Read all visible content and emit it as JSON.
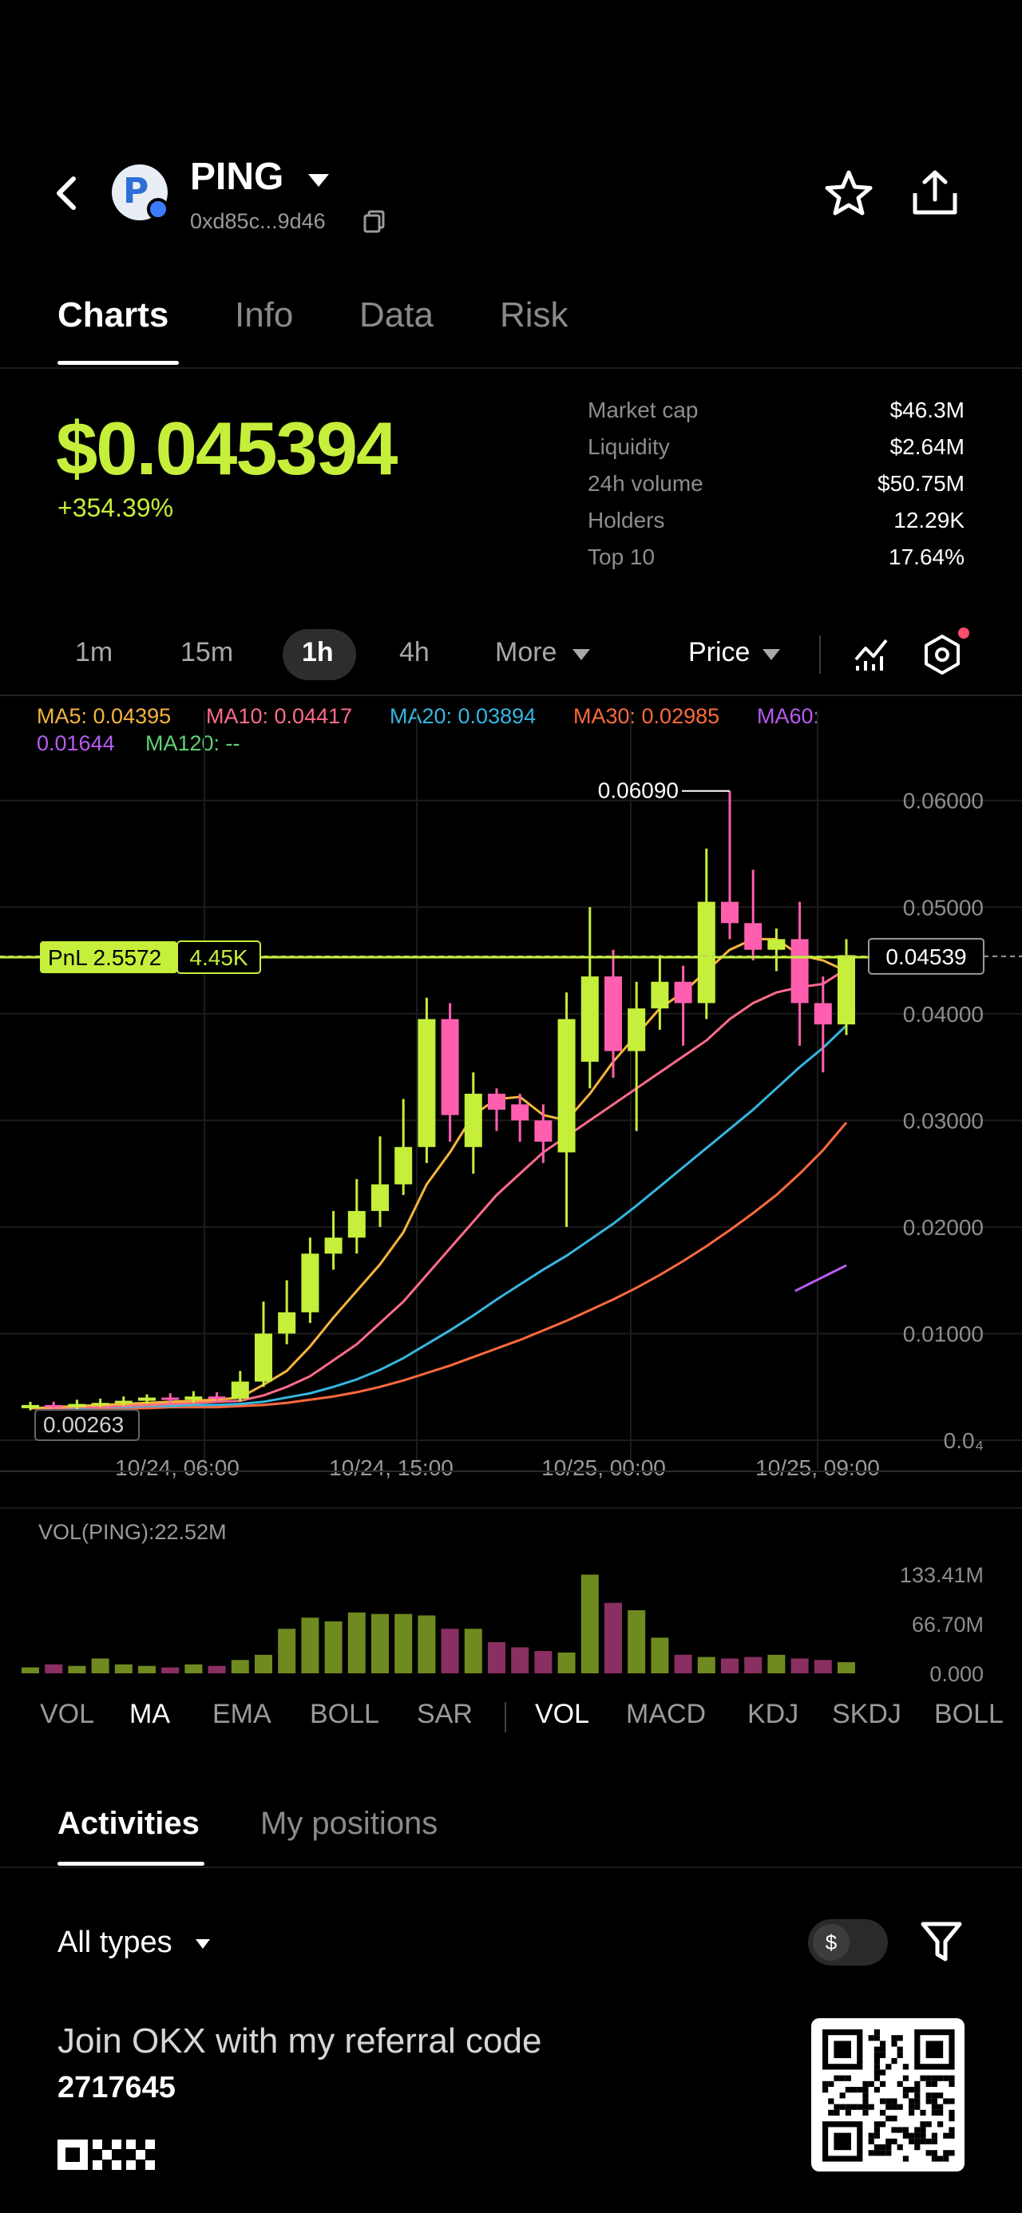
{
  "header": {
    "token_name": "PING",
    "token_address": "0xd85c...9d46"
  },
  "tabs": [
    {
      "label": "Charts",
      "active": true
    },
    {
      "label": "Info",
      "active": false
    },
    {
      "label": "Data",
      "active": false
    },
    {
      "label": "Risk",
      "active": false
    }
  ],
  "price": {
    "value": "$0.045394",
    "change": "+354.39%"
  },
  "stats": [
    {
      "label": "Market cap",
      "value": "$46.3M"
    },
    {
      "label": "Liquidity",
      "value": "$2.64M"
    },
    {
      "label": "24h volume",
      "value": "$50.75M"
    },
    {
      "label": "Holders",
      "value": "12.29K"
    },
    {
      "label": "Top 10",
      "value": "17.64%"
    }
  ],
  "timeframes": [
    "1m",
    "15m",
    "1h",
    "4h"
  ],
  "timeframe_active": "1h",
  "more_label": "More",
  "price_mode_label": "Price",
  "ma_legend": {
    "ma5": "MA5: 0.04395",
    "ma10": "MA10: 0.04417",
    "ma20": "MA20: 0.03894",
    "ma30": "MA30: 0.02985",
    "ma60_a": "MA60:",
    "ma60_b": "0.01644",
    "ma120": "MA120: --"
  },
  "colors": {
    "up": "#c5ef3a",
    "down": "#ff5fae",
    "ma5": "#f5b43c",
    "ma10": "#ff6b8a",
    "ma20": "#35b6e0",
    "ma30": "#ff6a3d",
    "ma60": "#b65cf0",
    "ma120": "#5fd37a"
  },
  "pnl": {
    "label": "PnL 2.5572",
    "amount": "4.45K"
  },
  "chart_data": {
    "type": "candlestick",
    "y_ticks": [
      "0.06000",
      "0.05000",
      "0.04000",
      "0.03000",
      "0.02000",
      "0.01000",
      "0.0₄"
    ],
    "ylim": [
      0,
      0.0635
    ],
    "x_ticks": [
      "10/24, 06:00",
      "10/24, 15:00",
      "10/25, 00:00",
      "10/25, 09:00"
    ],
    "high_label": "0.06090",
    "low_label": "0.00263",
    "current_price_label": "0.04539",
    "current_price": 0.04539,
    "candles": [
      {
        "o": 0.003,
        "c": 0.0033,
        "h": 0.0036,
        "l": 0.0028
      },
      {
        "o": 0.0033,
        "c": 0.0031,
        "h": 0.0036,
        "l": 0.0029
      },
      {
        "o": 0.0031,
        "c": 0.0034,
        "h": 0.0038,
        "l": 0.0029
      },
      {
        "o": 0.0034,
        "c": 0.0035,
        "h": 0.0039,
        "l": 0.0031
      },
      {
        "o": 0.0035,
        "c": 0.0037,
        "h": 0.0041,
        "l": 0.0032
      },
      {
        "o": 0.0037,
        "c": 0.004,
        "h": 0.0043,
        "l": 0.0034
      },
      {
        "o": 0.004,
        "c": 0.0038,
        "h": 0.0044,
        "l": 0.0035
      },
      {
        "o": 0.0038,
        "c": 0.0041,
        "h": 0.0046,
        "l": 0.0035
      },
      {
        "o": 0.0041,
        "c": 0.0039,
        "h": 0.0045,
        "l": 0.0036
      },
      {
        "o": 0.0039,
        "c": 0.0055,
        "h": 0.0065,
        "l": 0.0036
      },
      {
        "o": 0.0055,
        "c": 0.01,
        "h": 0.013,
        "l": 0.005
      },
      {
        "o": 0.01,
        "c": 0.012,
        "h": 0.015,
        "l": 0.009
      },
      {
        "o": 0.012,
        "c": 0.0175,
        "h": 0.019,
        "l": 0.011
      },
      {
        "o": 0.0175,
        "c": 0.019,
        "h": 0.0215,
        "l": 0.016
      },
      {
        "o": 0.019,
        "c": 0.0215,
        "h": 0.0245,
        "l": 0.0175
      },
      {
        "o": 0.0215,
        "c": 0.024,
        "h": 0.0285,
        "l": 0.02
      },
      {
        "o": 0.024,
        "c": 0.0275,
        "h": 0.032,
        "l": 0.023
      },
      {
        "o": 0.0275,
        "c": 0.0395,
        "h": 0.0415,
        "l": 0.026
      },
      {
        "o": 0.0395,
        "c": 0.0305,
        "h": 0.041,
        "l": 0.028
      },
      {
        "o": 0.0275,
        "c": 0.0325,
        "h": 0.0345,
        "l": 0.025
      },
      {
        "o": 0.0325,
        "c": 0.031,
        "h": 0.033,
        "l": 0.029
      },
      {
        "o": 0.0315,
        "c": 0.03,
        "h": 0.0325,
        "l": 0.028
      },
      {
        "o": 0.03,
        "c": 0.028,
        "h": 0.0315,
        "l": 0.026
      },
      {
        "o": 0.027,
        "c": 0.0395,
        "h": 0.042,
        "l": 0.02
      },
      {
        "o": 0.0355,
        "c": 0.0435,
        "h": 0.05,
        "l": 0.033
      },
      {
        "o": 0.0435,
        "c": 0.0365,
        "h": 0.046,
        "l": 0.034
      },
      {
        "o": 0.0365,
        "c": 0.0405,
        "h": 0.043,
        "l": 0.029
      },
      {
        "o": 0.0405,
        "c": 0.043,
        "h": 0.0455,
        "l": 0.0385
      },
      {
        "o": 0.043,
        "c": 0.041,
        "h": 0.0445,
        "l": 0.037
      },
      {
        "o": 0.041,
        "c": 0.0505,
        "h": 0.0555,
        "l": 0.0395
      },
      {
        "o": 0.0505,
        "c": 0.0485,
        "h": 0.0609,
        "l": 0.047
      },
      {
        "o": 0.0485,
        "c": 0.046,
        "h": 0.0535,
        "l": 0.045
      },
      {
        "o": 0.046,
        "c": 0.047,
        "h": 0.048,
        "l": 0.044
      },
      {
        "o": 0.047,
        "c": 0.041,
        "h": 0.0505,
        "l": 0.037
      },
      {
        "o": 0.041,
        "c": 0.039,
        "h": 0.0435,
        "l": 0.0345
      },
      {
        "o": 0.039,
        "c": 0.0455,
        "h": 0.047,
        "l": 0.038
      }
    ],
    "ma5": [
      0.003,
      0.0031,
      0.0032,
      0.0033,
      0.0034,
      0.0035,
      0.0036,
      0.0037,
      0.0038,
      0.004,
      0.0052,
      0.0065,
      0.0088,
      0.0115,
      0.014,
      0.0165,
      0.0195,
      0.024,
      0.027,
      0.0305,
      0.032,
      0.0322,
      0.0305,
      0.03,
      0.0325,
      0.0355,
      0.038,
      0.0405,
      0.042,
      0.044,
      0.046,
      0.047,
      0.047,
      0.0455,
      0.045,
      0.044
    ],
    "ma10": [
      0.003,
      0.003,
      0.0031,
      0.0031,
      0.0032,
      0.0033,
      0.0034,
      0.0035,
      0.0036,
      0.0037,
      0.0042,
      0.005,
      0.006,
      0.0075,
      0.009,
      0.011,
      0.013,
      0.0155,
      0.018,
      0.0205,
      0.023,
      0.025,
      0.027,
      0.0285,
      0.03,
      0.0315,
      0.033,
      0.0345,
      0.036,
      0.0375,
      0.0395,
      0.041,
      0.042,
      0.0425,
      0.0428,
      0.0442
    ],
    "ma20": [
      0.003,
      0.003,
      0.003,
      0.0031,
      0.0031,
      0.0032,
      0.0032,
      0.0033,
      0.0033,
      0.0034,
      0.0036,
      0.004,
      0.0044,
      0.005,
      0.0057,
      0.0066,
      0.0077,
      0.009,
      0.0103,
      0.0117,
      0.0132,
      0.0146,
      0.016,
      0.0173,
      0.0188,
      0.0203,
      0.022,
      0.0238,
      0.0256,
      0.0274,
      0.0292,
      0.031,
      0.033,
      0.035,
      0.0368,
      0.0389
    ],
    "ma30": [
      0.003,
      0.003,
      0.003,
      0.003,
      0.003,
      0.003,
      0.0031,
      0.0031,
      0.0031,
      0.0032,
      0.0033,
      0.0035,
      0.0038,
      0.0041,
      0.0045,
      0.005,
      0.0056,
      0.0063,
      0.007,
      0.0078,
      0.0086,
      0.0094,
      0.0103,
      0.0112,
      0.0122,
      0.0132,
      0.0143,
      0.0155,
      0.0168,
      0.0182,
      0.0197,
      0.0213,
      0.023,
      0.025,
      0.0272,
      0.0298
    ],
    "ma60": [
      0.014,
      0.0164
    ],
    "volume_label": "VOL(PING):22.52M",
    "volume_ticks": [
      "133.41M",
      "66.70M",
      "0.000"
    ],
    "volume_max": 133.41,
    "volumes": [
      8,
      12,
      10,
      20,
      12,
      10,
      8,
      12,
      10,
      18,
      25,
      60,
      75,
      70,
      82,
      80,
      80,
      78,
      60,
      60,
      42,
      35,
      30,
      28,
      133,
      95,
      85,
      48,
      25,
      22,
      20,
      22,
      25,
      20,
      18,
      15
    ]
  },
  "indicators": [
    {
      "label": "VOL",
      "active": false
    },
    {
      "label": "MA",
      "active": true
    },
    {
      "label": "EMA",
      "active": false
    },
    {
      "label": "BOLL",
      "active": false
    },
    {
      "label": "SAR",
      "active": false
    },
    {
      "label": "VOL",
      "active": true
    },
    {
      "label": "MACD",
      "active": false
    },
    {
      "label": "KDJ",
      "active": false
    },
    {
      "label": "SKDJ",
      "active": false
    },
    {
      "label": "BOLL",
      "active": false
    }
  ],
  "activity_tabs": [
    {
      "label": "Activities",
      "active": true
    },
    {
      "label": "My positions",
      "active": false
    }
  ],
  "filter_label": "All types",
  "toggle_symbol": "$",
  "footer": {
    "referral_text": "Join OKX with my referral code",
    "referral_code": "2717645",
    "logo_text": "OKX"
  }
}
